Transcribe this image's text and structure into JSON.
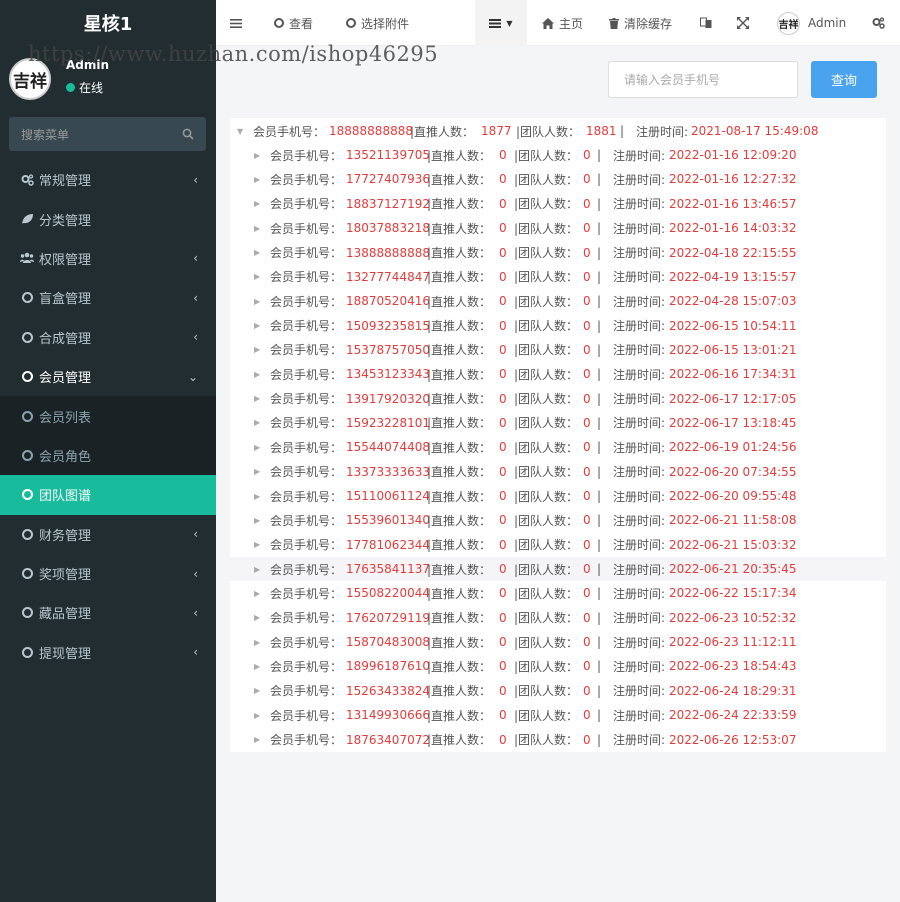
{
  "watermark": "https://www.huzhan.com/ishop46295",
  "app": {
    "title": "星核1"
  },
  "user": {
    "name": "Admin",
    "status": "在线",
    "avatar_text": "吉祥"
  },
  "search": {
    "placeholder": "搜索菜单"
  },
  "menu": [
    {
      "label": "常规管理",
      "icon": "gears-icon",
      "chevron": "‹"
    },
    {
      "label": "分类管理",
      "icon": "leaf-icon",
      "chevron": ""
    },
    {
      "label": "权限管理",
      "icon": "group-icon",
      "chevron": "‹"
    },
    {
      "label": "盲盒管理",
      "icon": "circle-icon",
      "chevron": "‹"
    },
    {
      "label": "合成管理",
      "icon": "circle-icon",
      "chevron": "‹"
    },
    {
      "label": "会员管理",
      "icon": "circle-icon",
      "chevron": "⌄"
    },
    {
      "label": "会员列表",
      "icon": "circle-icon",
      "chevron": ""
    },
    {
      "label": "会员角色",
      "icon": "circle-icon",
      "chevron": ""
    },
    {
      "label": "团队图谱",
      "icon": "circle-icon",
      "chevron": ""
    },
    {
      "label": "财务管理",
      "icon": "circle-icon",
      "chevron": "‹"
    },
    {
      "label": "奖项管理",
      "icon": "circle-icon",
      "chevron": "‹"
    },
    {
      "label": "藏品管理",
      "icon": "circle-icon",
      "chevron": "‹"
    },
    {
      "label": "提现管理",
      "icon": "circle-icon",
      "chevron": "‹"
    }
  ],
  "topbar": {
    "view_label": "查看",
    "attach_label": "选择附件",
    "home_label": "主页",
    "clear_cache_label": "清除缓存",
    "admin_label": "Admin"
  },
  "query": {
    "placeholder": "请输入会员手机号",
    "button_label": "查询"
  },
  "labels": {
    "phone": "会员手机号：",
    "direct": "|直推人数：",
    "team": "|团队人数：",
    "pipe": "|",
    "reg": "注册时间:"
  },
  "tree": {
    "root": {
      "phone": "18888888888",
      "direct": "1877",
      "team": "1881",
      "reg": "2021-08-17 15:49:08"
    },
    "children": [
      {
        "phone": "13521139705",
        "direct": "0",
        "team": "0",
        "reg": "2022-01-16 12:09:20"
      },
      {
        "phone": "17727407936",
        "direct": "0",
        "team": "0",
        "reg": "2022-01-16 12:27:32"
      },
      {
        "phone": "18837127192",
        "direct": "0",
        "team": "0",
        "reg": "2022-01-16 13:46:57"
      },
      {
        "phone": "18037883218",
        "direct": "0",
        "team": "0",
        "reg": "2022-01-16 14:03:32"
      },
      {
        "phone": "13888888888",
        "direct": "0",
        "team": "0",
        "reg": "2022-04-18 22:15:55"
      },
      {
        "phone": "13277744847",
        "direct": "0",
        "team": "0",
        "reg": "2022-04-19 13:15:57"
      },
      {
        "phone": "18870520416",
        "direct": "0",
        "team": "0",
        "reg": "2022-04-28 15:07:03"
      },
      {
        "phone": "15093235815",
        "direct": "0",
        "team": "0",
        "reg": "2022-06-15 10:54:11"
      },
      {
        "phone": "15378757050",
        "direct": "0",
        "team": "0",
        "reg": "2022-06-15 13:01:21"
      },
      {
        "phone": "13453123343",
        "direct": "0",
        "team": "0",
        "reg": "2022-06-16 17:34:31"
      },
      {
        "phone": "13917920320",
        "direct": "0",
        "team": "0",
        "reg": "2022-06-17 12:17:05"
      },
      {
        "phone": "15923228101",
        "direct": "0",
        "team": "0",
        "reg": "2022-06-17 13:18:45"
      },
      {
        "phone": "15544074408",
        "direct": "0",
        "team": "0",
        "reg": "2022-06-19 01:24:56"
      },
      {
        "phone": "13373333633",
        "direct": "0",
        "team": "0",
        "reg": "2022-06-20 07:34:55"
      },
      {
        "phone": "15110061124",
        "direct": "0",
        "team": "0",
        "reg": "2022-06-20 09:55:48"
      },
      {
        "phone": "15539601340",
        "direct": "0",
        "team": "0",
        "reg": "2022-06-21 11:58:08"
      },
      {
        "phone": "17781062344",
        "direct": "0",
        "team": "0",
        "reg": "2022-06-21 15:03:32"
      },
      {
        "phone": "17635841137",
        "direct": "0",
        "team": "0",
        "reg": "2022-06-21 20:35:45"
      },
      {
        "phone": "15508220044",
        "direct": "0",
        "team": "0",
        "reg": "2022-06-22 15:17:34"
      },
      {
        "phone": "17620729119",
        "direct": "0",
        "team": "0",
        "reg": "2022-06-23 10:52:32"
      },
      {
        "phone": "15870483008",
        "direct": "0",
        "team": "0",
        "reg": "2022-06-23 11:12:11"
      },
      {
        "phone": "18996187610",
        "direct": "0",
        "team": "0",
        "reg": "2022-06-23 18:54:43"
      },
      {
        "phone": "15263433824",
        "direct": "0",
        "team": "0",
        "reg": "2022-06-24 18:29:31"
      },
      {
        "phone": "13149930666",
        "direct": "0",
        "team": "0",
        "reg": "2022-06-24 22:33:59"
      },
      {
        "phone": "18763407072",
        "direct": "0",
        "team": "0",
        "reg": "2022-06-26 12:53:07"
      }
    ]
  },
  "colors": {
    "sidebar": "#222d32",
    "accent": "#18bc9c",
    "primary": "#4aa3ee",
    "value_red": "#e63b3b"
  }
}
